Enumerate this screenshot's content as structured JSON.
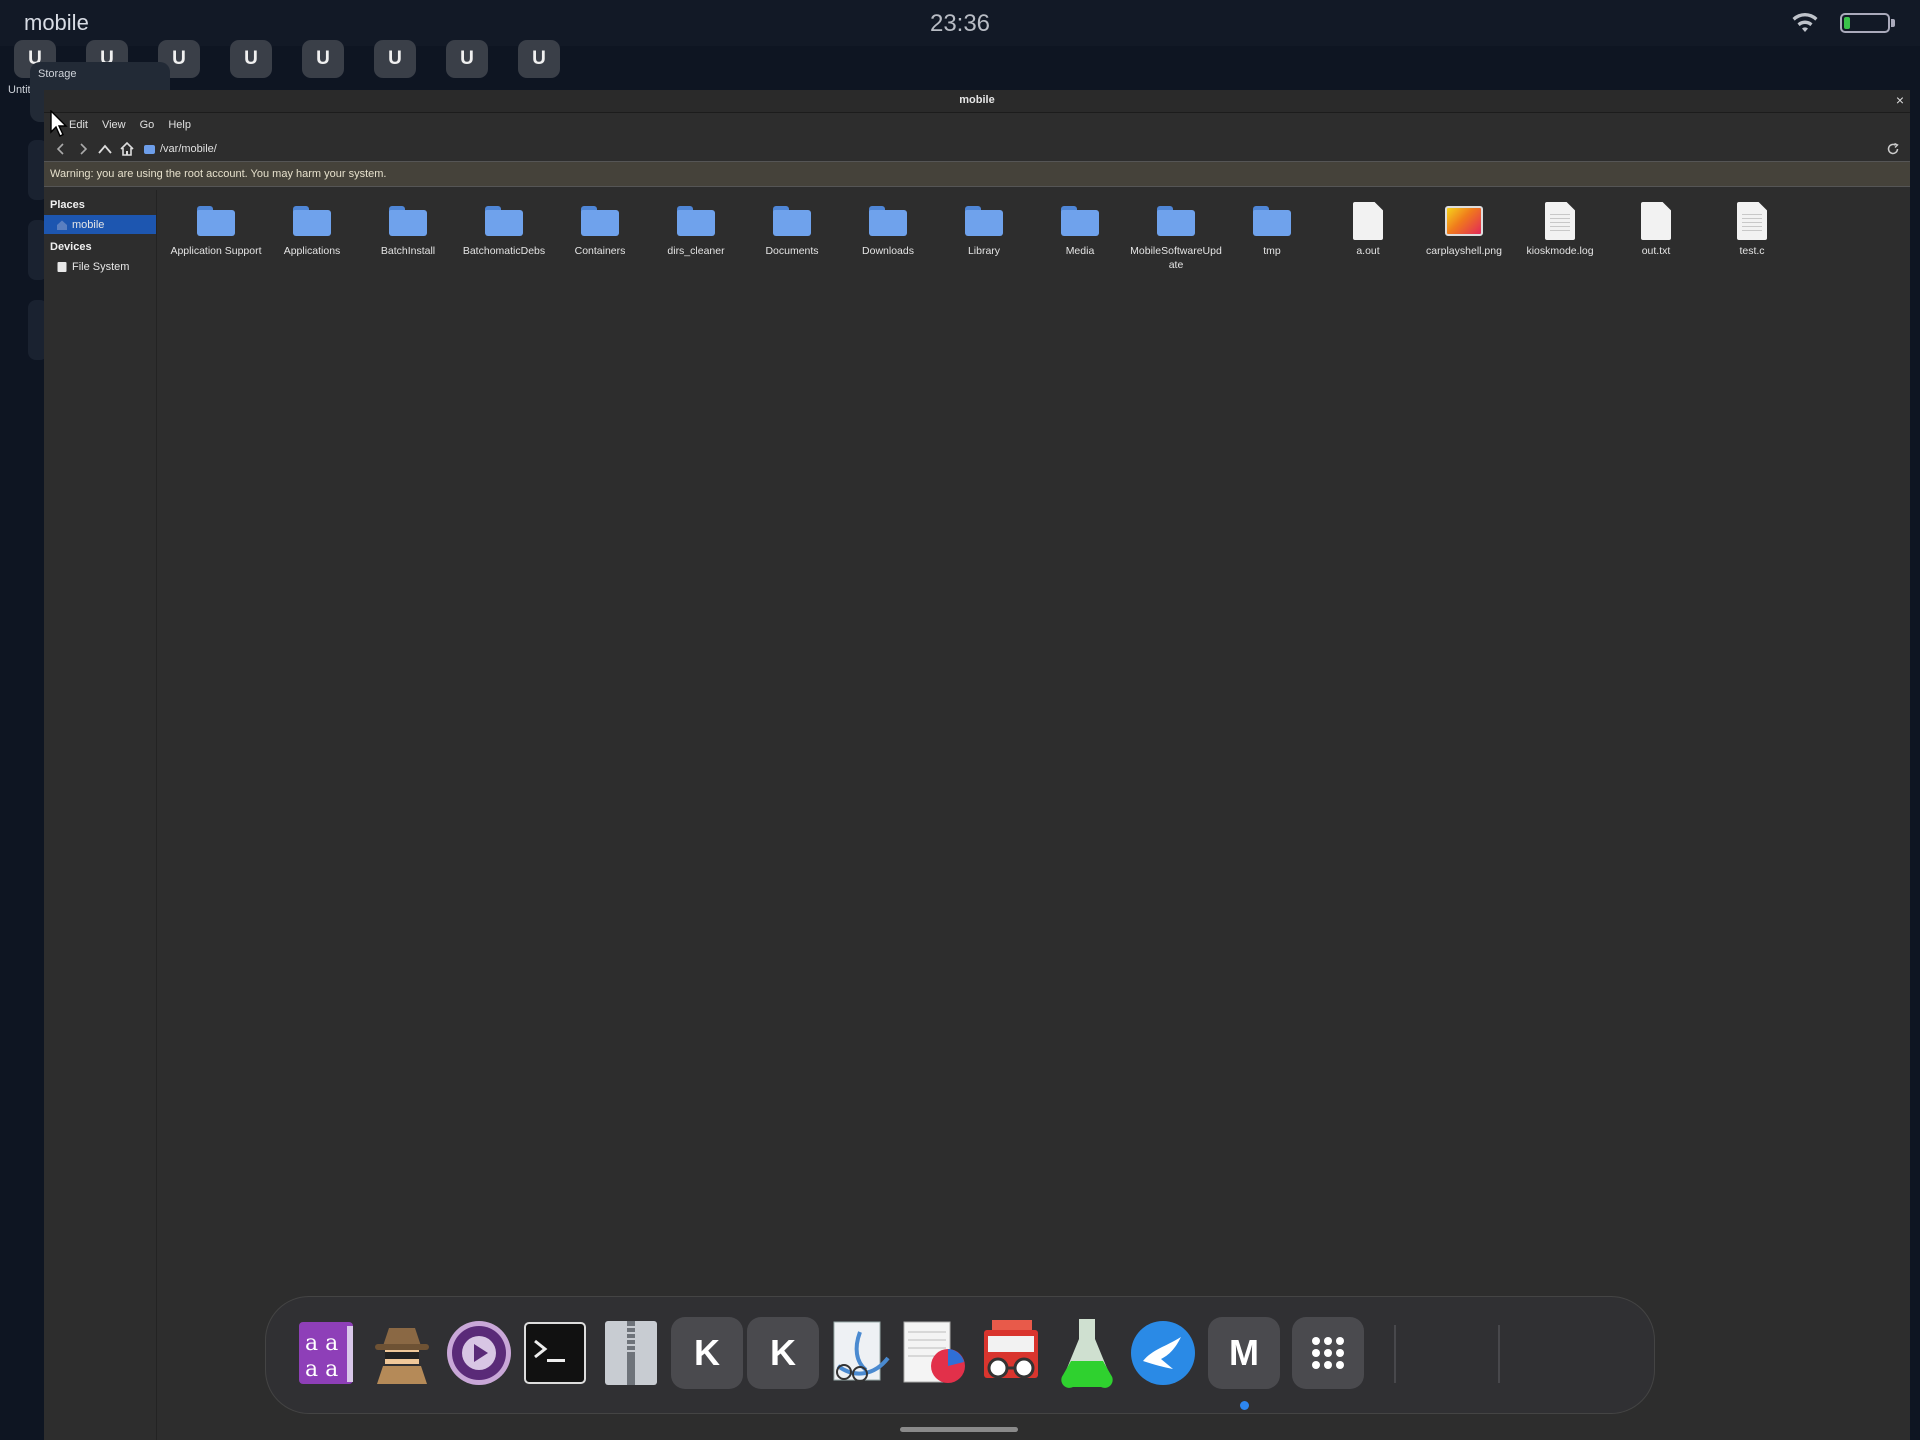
{
  "statusbar": {
    "device_name": "mobile",
    "time": "23:36"
  },
  "background_apps": {
    "icons": [
      "U",
      "U",
      "U",
      "U",
      "U",
      "U",
      "U",
      "U"
    ],
    "first_caption": "Untitle",
    "storage_label": "Storage"
  },
  "window": {
    "title": "mobile",
    "close_glyph": "×",
    "menu": [
      "Edit",
      "View",
      "Go",
      "Help"
    ],
    "path": "/var/mobile/",
    "warning": "Warning: you are using the root account. You may harm your system."
  },
  "sidebar": {
    "places_header": "Places",
    "places": [
      {
        "label": "mobile",
        "icon": "home-folder-icon",
        "selected": true
      }
    ],
    "devices_header": "Devices",
    "devices": [
      {
        "label": "File System",
        "icon": "drive-icon"
      }
    ]
  },
  "files": [
    {
      "name": "Application Support",
      "type": "folder"
    },
    {
      "name": "Applications",
      "type": "folder"
    },
    {
      "name": "BatchInstall",
      "type": "folder"
    },
    {
      "name": "BatchomaticDebs",
      "type": "folder"
    },
    {
      "name": "Containers",
      "type": "folder"
    },
    {
      "name": "dirs_cleaner",
      "type": "folder"
    },
    {
      "name": "Documents",
      "type": "folder"
    },
    {
      "name": "Downloads",
      "type": "folder"
    },
    {
      "name": "Library",
      "type": "folder"
    },
    {
      "name": "Media",
      "type": "folder"
    },
    {
      "name": "MobileSoftwareUpdate",
      "type": "folder"
    },
    {
      "name": "tmp",
      "type": "folder"
    },
    {
      "name": "a.out",
      "type": "file"
    },
    {
      "name": "carplayshell.png",
      "type": "image"
    },
    {
      "name": "kioskmode.log",
      "type": "text"
    },
    {
      "name": "out.txt",
      "type": "file"
    },
    {
      "name": "test.c",
      "type": "text"
    }
  ],
  "dock": {
    "apps": [
      {
        "name": "dictionary-app-icon"
      },
      {
        "name": "spy-app-icon"
      },
      {
        "name": "media-player-icon"
      },
      {
        "name": "terminal-icon"
      },
      {
        "name": "archiver-icon"
      },
      {
        "name": "k-app-icon",
        "letter": "K"
      },
      {
        "name": "k-app-icon",
        "letter": "K"
      },
      {
        "name": "text-editor-icon"
      },
      {
        "name": "presentation-icon"
      },
      {
        "name": "document-viewer-icon"
      },
      {
        "name": "flask-icon"
      },
      {
        "name": "bird-app-icon"
      },
      {
        "name": "m-app-icon",
        "letter": "M",
        "running": true
      },
      {
        "name": "app-grid-icon"
      }
    ]
  },
  "colors": {
    "accent": "#1d56b0",
    "folder": "#6fa2ec",
    "dock_indicator": "#2d86f0"
  }
}
